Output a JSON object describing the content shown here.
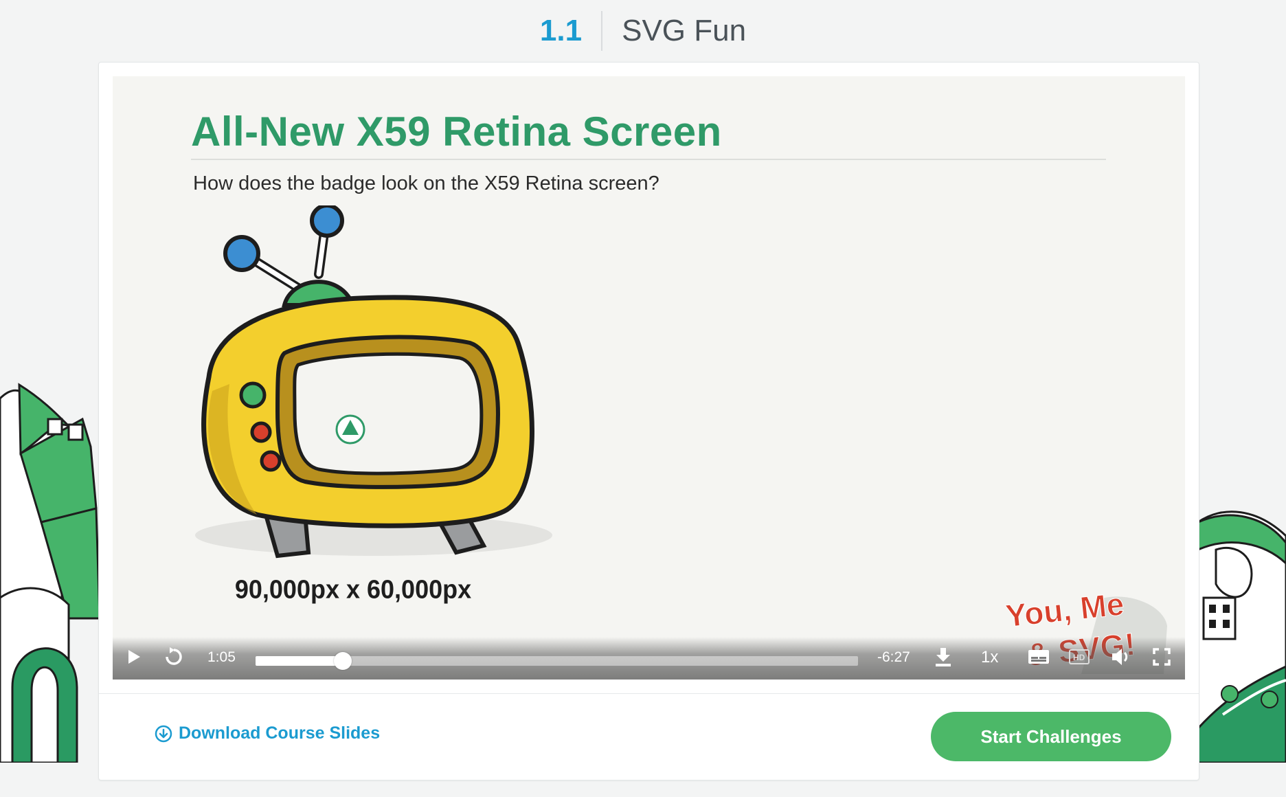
{
  "header": {
    "lesson_number": "1.1",
    "lesson_title": "SVG Fun"
  },
  "slide": {
    "title": "All-New X59 Retina Screen",
    "subtitle": "How does the badge look on the X59 Retina screen?",
    "dimensions_label": "90,000px x 60,000px",
    "sticker_line1": "You, Me",
    "sticker_line2": "& SVG!"
  },
  "player": {
    "elapsed": "1:05",
    "remaining": "-6:27",
    "progress_percent": 14.5,
    "speed": "1x",
    "icons": [
      "play-icon",
      "replay-icon",
      "download-icon",
      "captions-icon",
      "hd-icon",
      "volume-icon",
      "fullscreen-icon"
    ]
  },
  "footer": {
    "download_label": "Download Course Slides",
    "start_label": "Start Challenges"
  },
  "colors": {
    "accent_blue": "#1b9bd0",
    "slide_green": "#2f9a68",
    "button_green": "#4cb868",
    "tv_yellow": "#f3cf2d",
    "sticker_red": "#d8402c"
  }
}
